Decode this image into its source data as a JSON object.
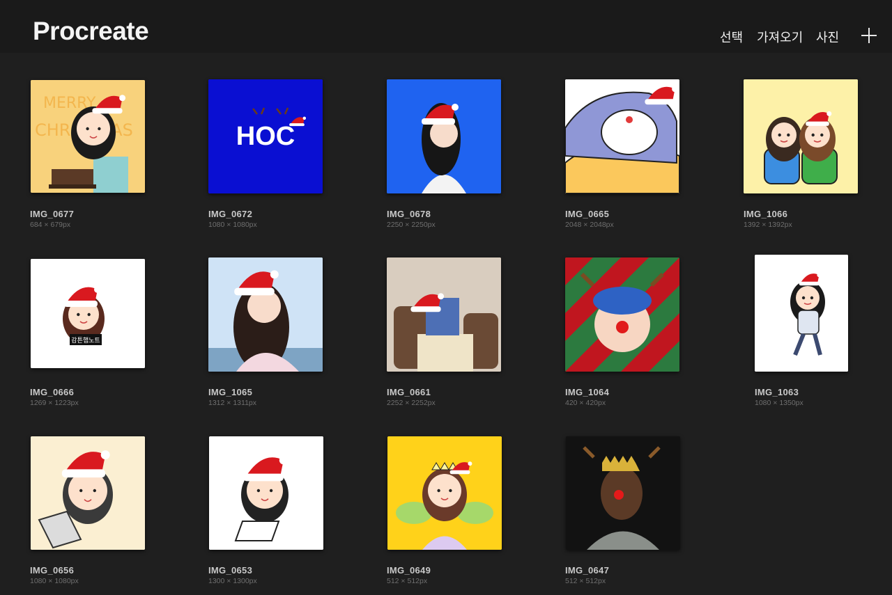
{
  "app": {
    "title": "Procreate"
  },
  "toolbar": {
    "select_label": "선택",
    "import_label": "가져오기",
    "photo_label": "사진",
    "new_icon": "plus-icon"
  },
  "artworks": [
    {
      "name": "IMG_0677",
      "dims": "684 × 679px",
      "bg": "#f8d27c"
    },
    {
      "name": "IMG_0672",
      "dims": "1080 × 1080px",
      "bg": "#0a0fd2",
      "text": "HOC"
    },
    {
      "name": "IMG_0678",
      "dims": "2250 × 2250px",
      "bg": "#1f63f0"
    },
    {
      "name": "IMG_0665",
      "dims": "2048 × 2048px",
      "bg": "#ffffff"
    },
    {
      "name": "IMG_1066",
      "dims": "1392 × 1392px",
      "bg": "#fdf1a8"
    },
    {
      "name": "IMG_0666",
      "dims": "1269 × 1223px",
      "bg": "#ffffff"
    },
    {
      "name": "IMG_1065",
      "dims": "1312 × 1311px",
      "bg": "#cfe3f6"
    },
    {
      "name": "IMG_0661",
      "dims": "2252 × 2252px",
      "bg": "#d9cdbf"
    },
    {
      "name": "IMG_1064",
      "dims": "420 × 420px",
      "bg": "#c0161f"
    },
    {
      "name": "IMG_1063",
      "dims": "1080 × 1350px",
      "bg": "#ffffff"
    },
    {
      "name": "IMG_0656",
      "dims": "1080 × 1080px",
      "bg": "#fbefd2"
    },
    {
      "name": "IMG_0653",
      "dims": "1300 × 1300px",
      "bg": "#ffffff"
    },
    {
      "name": "IMG_0649",
      "dims": "512 × 512px",
      "bg": "#ffd21a"
    },
    {
      "name": "IMG_0647",
      "dims": "512 × 512px",
      "bg": "#121212"
    }
  ]
}
